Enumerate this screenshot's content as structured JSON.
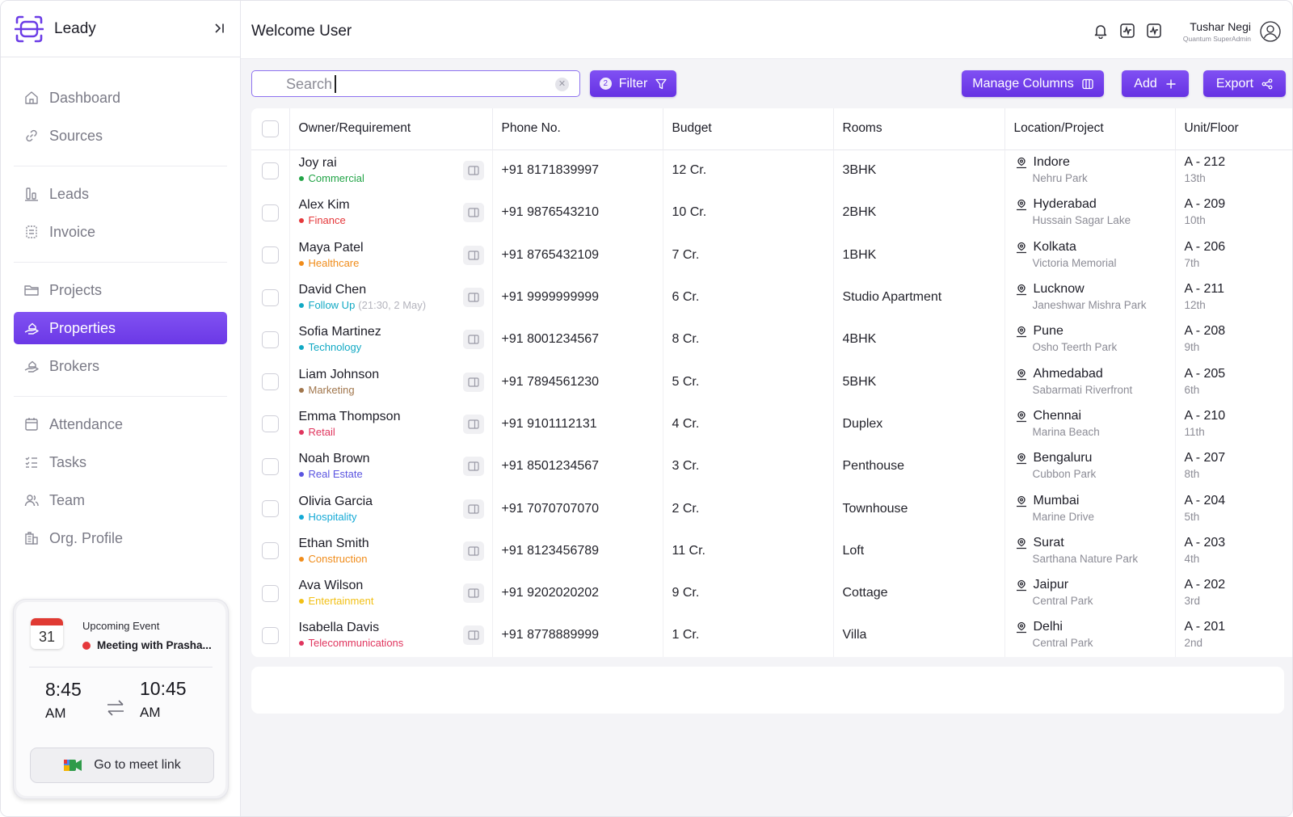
{
  "app": {
    "name": "Leady"
  },
  "header": {
    "welcome": "Welcome User",
    "user_name": "Tushar Negi",
    "user_role": "Quantum SuperAdmin"
  },
  "sidebar": {
    "groups": [
      [
        {
          "label": "Dashboard",
          "icon": "home-icon"
        },
        {
          "label": "Sources",
          "icon": "link-icon"
        }
      ],
      [
        {
          "label": "Leads",
          "icon": "bar-chart-icon"
        },
        {
          "label": "Invoice",
          "icon": "invoice-icon"
        }
      ],
      [
        {
          "label": "Projects",
          "icon": "folder-icon"
        },
        {
          "label": "Properties",
          "icon": "hand-home-icon",
          "active": true
        },
        {
          "label": "Brokers",
          "icon": "hand-home-icon"
        }
      ],
      [
        {
          "label": "Attendance",
          "icon": "calendar-icon"
        },
        {
          "label": "Tasks",
          "icon": "tasks-icon"
        },
        {
          "label": "Team",
          "icon": "team-icon"
        },
        {
          "label": "Org. Profile",
          "icon": "building-icon"
        }
      ]
    ]
  },
  "event": {
    "day": "31",
    "label": "Upcoming Event",
    "title": "Meeting with Prasha...",
    "start_time": "8:45",
    "start_ampm": "AM",
    "end_time": "10:45",
    "end_ampm": "AM",
    "meet_label": "Go to meet link"
  },
  "toolbar": {
    "search_placeholder": "Search",
    "filter_label": "Filter",
    "filter_count": "2",
    "manage_columns_label": "Manage Columns",
    "add_label": "Add",
    "export_label": "Export"
  },
  "table": {
    "columns": [
      "Owner/Requirement",
      "Phone No.",
      "Budget",
      "Rooms",
      "Location/Project",
      "Unit/Floor"
    ],
    "rows": [
      {
        "name": "Joy rai",
        "tag": "Commercial",
        "tag_color": "#22a447",
        "extra": "",
        "phone": "+91 8171839997",
        "budget": "12 Cr.",
        "rooms": "3BHK",
        "city": "Indore",
        "area": "Nehru Park",
        "unit": "A - 212",
        "floor": "13th"
      },
      {
        "name": "Alex Kim",
        "tag": "Finance",
        "tag_color": "#e5383b",
        "extra": "",
        "phone": "+91 9876543210",
        "budget": "10 Cr.",
        "rooms": "2BHK",
        "city": "Hyderabad",
        "area": "Hussain Sagar Lake",
        "unit": "A - 209",
        "floor": "10th"
      },
      {
        "name": "Maya Patel",
        "tag": "Healthcare",
        "tag_color": "#f08c1a",
        "extra": "",
        "phone": "+91 8765432109",
        "budget": "7 Cr.",
        "rooms": "1BHK",
        "city": "Kolkata",
        "area": "Victoria Memorial",
        "unit": "A - 206",
        "floor": "7th"
      },
      {
        "name": "David Chen",
        "tag": "Follow Up",
        "tag_color": "#11a9c4",
        "extra": "(21:30, 2 May)",
        "phone": "+91 9999999999",
        "budget": "6 Cr.",
        "rooms": "Studio Apartment",
        "city": "Lucknow",
        "area": "Janeshwar Mishra Park",
        "unit": "A - 211",
        "floor": "12th"
      },
      {
        "name": "Sofia Martinez",
        "tag": "Technology",
        "tag_color": "#11a9c4",
        "extra": "",
        "phone": "+91 8001234567",
        "budget": "8 Cr.",
        "rooms": "4BHK",
        "city": "Pune",
        "area": "Osho Teerth Park",
        "unit": "A - 208",
        "floor": "9th"
      },
      {
        "name": "Liam Johnson",
        "tag": "Marketing",
        "tag_color": "#a1764c",
        "extra": "",
        "phone": "+91 7894561230",
        "budget": "5 Cr.",
        "rooms": "5BHK",
        "city": "Ahmedabad",
        "area": "Sabarmati Riverfront",
        "unit": "A - 205",
        "floor": "6th"
      },
      {
        "name": "Emma Thompson",
        "tag": "Retail",
        "tag_color": "#e0355e",
        "extra": "",
        "phone": "+91 9101112131",
        "budget": "4 Cr.",
        "rooms": "Duplex",
        "city": "Chennai",
        "area": "Marina Beach",
        "unit": "A - 210",
        "floor": "11th"
      },
      {
        "name": "Noah Brown",
        "tag": "Real Estate",
        "tag_color": "#5a54e0",
        "extra": "",
        "phone": "+91 8501234567",
        "budget": "3 Cr.",
        "rooms": "Penthouse",
        "city": "Bengaluru",
        "area": "Cubbon Park",
        "unit": "A - 207",
        "floor": "8th"
      },
      {
        "name": "Olivia Garcia",
        "tag": "Hospitality",
        "tag_color": "#14a9d6",
        "extra": "",
        "phone": "+91 7070707070",
        "budget": "2 Cr.",
        "rooms": "Townhouse",
        "city": "Mumbai",
        "area": "Marine Drive",
        "unit": "A - 204",
        "floor": "5th"
      },
      {
        "name": "Ethan Smith",
        "tag": "Construction",
        "tag_color": "#f08c1a",
        "extra": "",
        "phone": "+91 8123456789",
        "budget": "11 Cr.",
        "rooms": "Loft",
        "city": "Surat",
        "area": "Sarthana Nature Park",
        "unit": "A - 203",
        "floor": "4th"
      },
      {
        "name": "Ava Wilson",
        "tag": "Entertainment",
        "tag_color": "#f2c016",
        "extra": "",
        "phone": "+91 9202020202",
        "budget": "9 Cr.",
        "rooms": "Cottage",
        "city": "Jaipur",
        "area": "Central Park",
        "unit": "A - 202",
        "floor": "3rd"
      },
      {
        "name": "Isabella Davis",
        "tag": "Telecommunications",
        "tag_color": "#e0355e",
        "extra": "",
        "phone": "+91 8778889999",
        "budget": "1 Cr.",
        "rooms": "Villa",
        "city": "Delhi",
        "area": "Central Park",
        "unit": "A - 201",
        "floor": "2nd"
      }
    ]
  }
}
